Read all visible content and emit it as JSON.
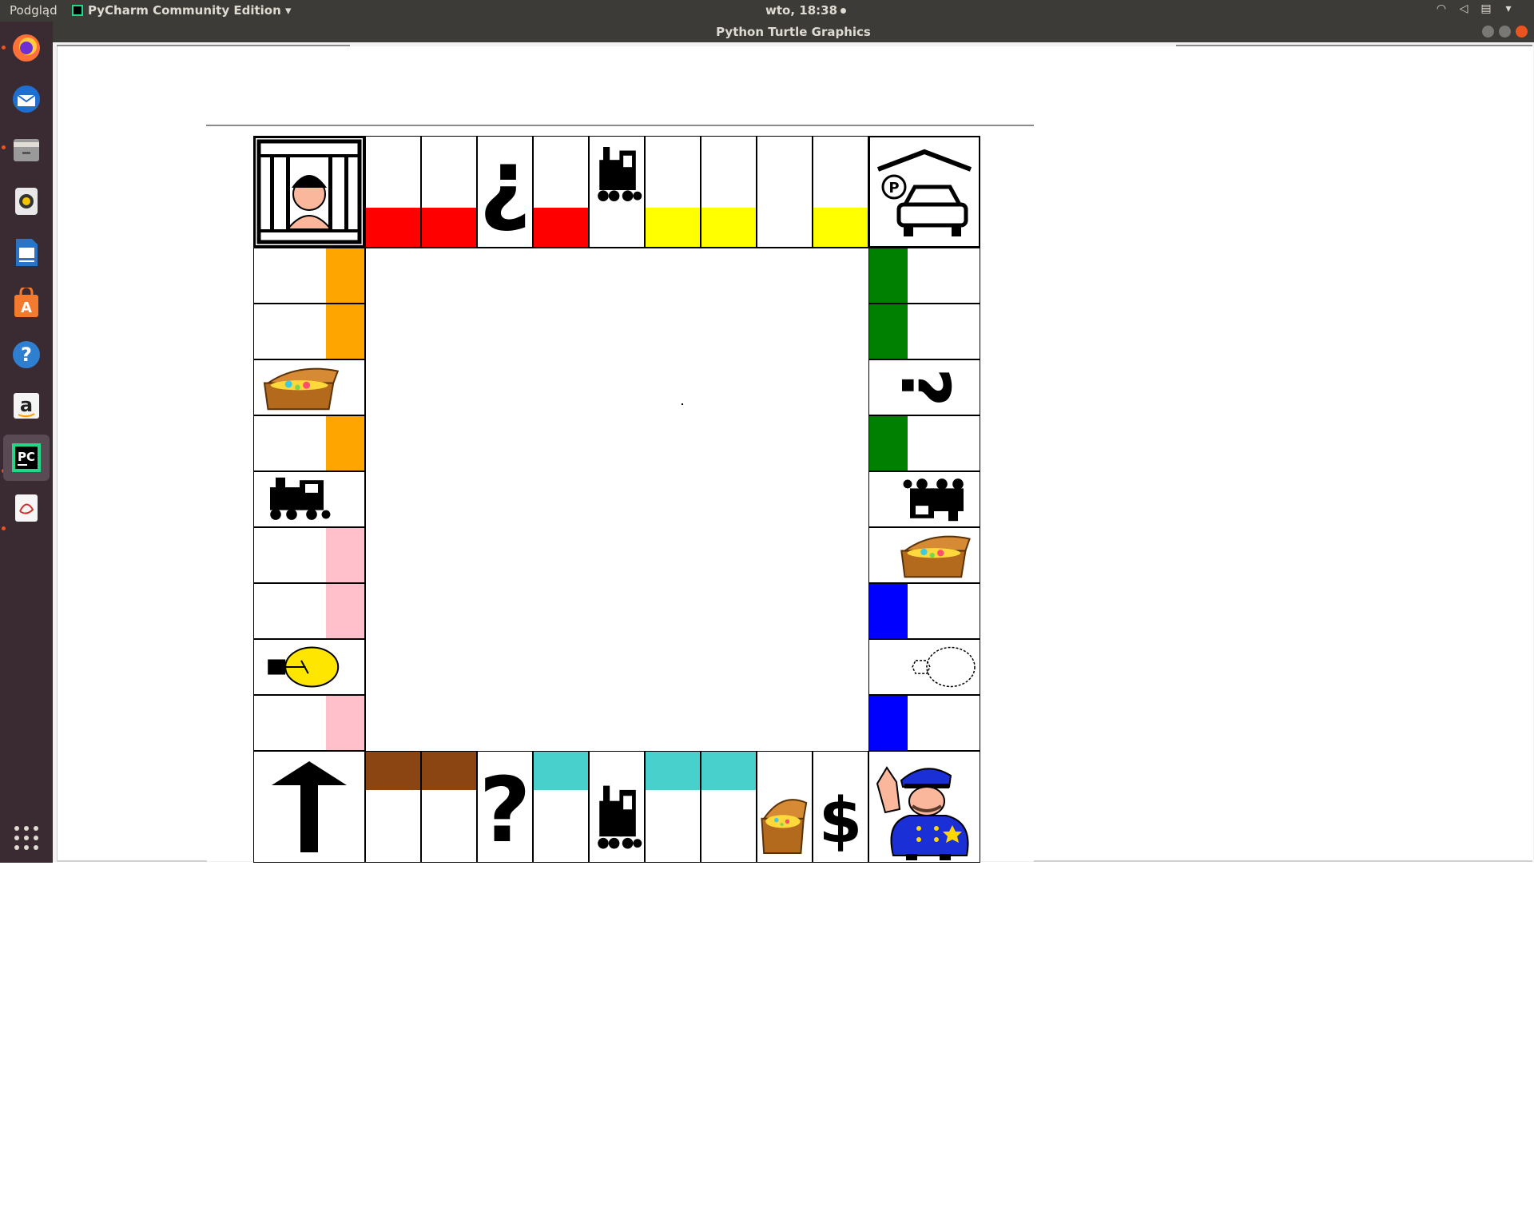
{
  "top_panel": {
    "activities": "Podgląd",
    "app_menu": "PyCharm Community Edition ▾",
    "clock": "wto, 18:38"
  },
  "window": {
    "title": "Python Turtle Graphics"
  },
  "launcher": {
    "apps": [
      "firefox-icon",
      "thunderbird-icon",
      "files-icon",
      "rhythmbox-icon",
      "libreoffice-writer-icon",
      "software-center-icon",
      "help-icon",
      "amazon-icon",
      "pycharm-icon",
      "evince-icon",
      "show-apps-icon"
    ]
  },
  "board": {
    "colors": {
      "red": "#ff0000",
      "yellow": "#ffff00",
      "orange": "#ffa500",
      "green": "#008000",
      "pink": "#ffc0cb",
      "blue": "#0000ff",
      "brown": "#8b4513",
      "cyan": "#48d1cc"
    },
    "top_row": [
      "jail-corner",
      "red",
      "red",
      "chance-inverted",
      "red",
      "train",
      "yellow",
      "yellow",
      "blank",
      "yellow",
      "parking-corner"
    ],
    "left_column": [
      "orange",
      "orange",
      "treasure-chest",
      "orange",
      "train",
      "pink",
      "pink",
      "light-bulb",
      "pink"
    ],
    "right_column": [
      "green",
      "green",
      "chance-rotated",
      "green",
      "train",
      "treasure-chest",
      "blue",
      "diamond-ring",
      "blue"
    ],
    "bottom_row": [
      "go-arrow-corner",
      "brown",
      "brown",
      "chance",
      "cyan",
      "train",
      "cyan",
      "cyan",
      "treasure-chest",
      "tax",
      "police-corner"
    ],
    "question_mark": "?",
    "inverted_question_mark": "¿",
    "dollar": "$"
  }
}
